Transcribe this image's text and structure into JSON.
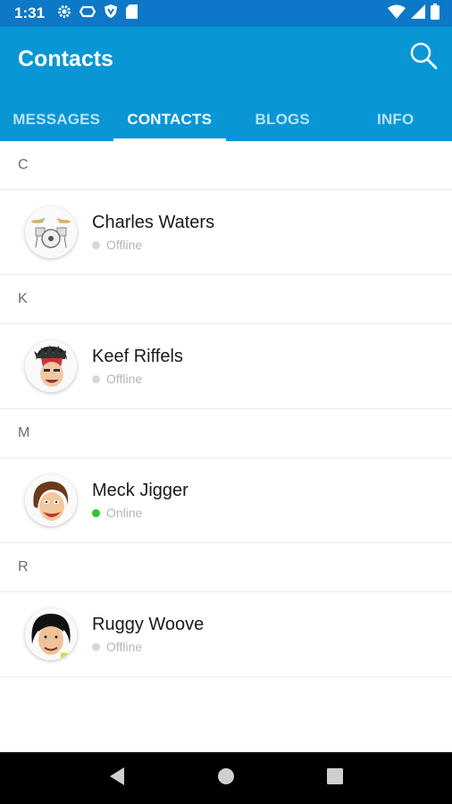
{
  "status_bar": {
    "time": "1:31",
    "left_icons": [
      "gear-icon",
      "sync-icon",
      "shield-icon",
      "sd-card-icon"
    ],
    "right_icons": [
      "wifi-icon",
      "cell-signal-icon",
      "battery-icon"
    ]
  },
  "app_bar": {
    "title": "Contacts",
    "search_icon": "search-icon"
  },
  "tabs": [
    {
      "label": "MESSAGES",
      "active": false
    },
    {
      "label": "CONTACTS",
      "active": true
    },
    {
      "label": "BLOGS",
      "active": false
    },
    {
      "label": "INFO",
      "active": false
    }
  ],
  "sections": [
    {
      "letter": "C",
      "contacts": [
        {
          "name": "Charles Waters",
          "status": "Offline",
          "avatar": "drum-kit"
        }
      ]
    },
    {
      "letter": "K",
      "contacts": [
        {
          "name": "Keef Riffels",
          "status": "Offline",
          "avatar": "caricature"
        }
      ]
    },
    {
      "letter": "M",
      "contacts": [
        {
          "name": "Meck Jigger",
          "status": "Online",
          "avatar": "caricature"
        }
      ]
    },
    {
      "letter": "R",
      "contacts": [
        {
          "name": "Ruggy Woove",
          "status": "Offline",
          "avatar": "caricature"
        }
      ]
    }
  ],
  "colors": {
    "app_bar": "#0896d5",
    "status_bar": "#0d78c8",
    "online": "#2fc42f",
    "offline": "#d6d6d6"
  },
  "nav_bar": [
    "back-icon",
    "home-icon",
    "recents-icon"
  ]
}
